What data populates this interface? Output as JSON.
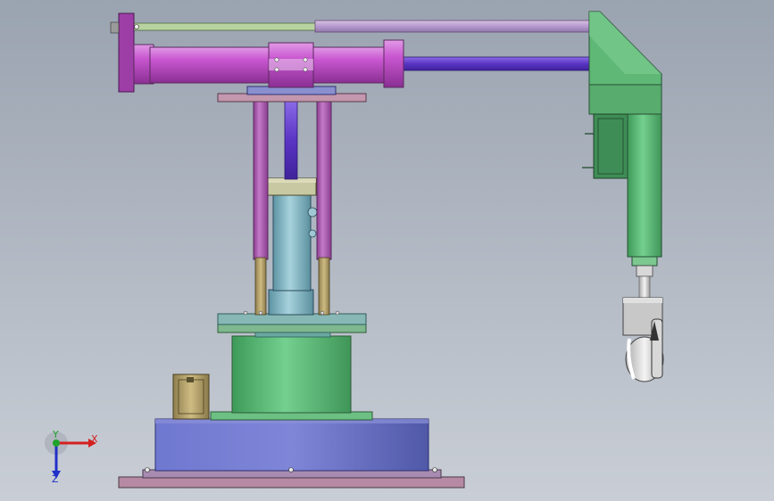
{
  "viewport": {
    "background_top": "#9aa3b0",
    "background_bottom": "#c9ced6"
  },
  "model": {
    "parts": [
      "base-plate",
      "base-housing",
      "gear-motor",
      "turret-cylinder",
      "lift-column",
      "guide-rods",
      "lift-screw",
      "top-plate",
      "main-cylinder",
      "extension-rod",
      "upper-guide-rod",
      "wrist-housing",
      "wrist-motor",
      "gripper"
    ],
    "colors": {
      "magenta": "#c24fc9",
      "violet": "#6a3bd1",
      "green": "#5ec27a",
      "blue": "#6f75c9",
      "cyan": "#7fb2c0",
      "tan": "#b6a46a",
      "rose": "#b78aa4"
    }
  },
  "triad": {
    "x_label": "X",
    "y_label": "Y",
    "z_label": "Z",
    "x_color": "#d42020",
    "y_color": "#1fa32a",
    "z_color": "#2030c8"
  }
}
